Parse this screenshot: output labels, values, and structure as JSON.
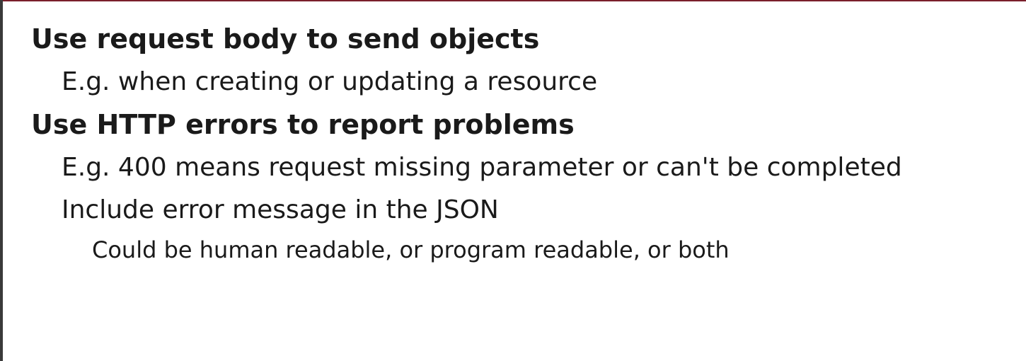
{
  "slide": {
    "items": [
      {
        "heading": "Use request body to send objects",
        "subitems": [
          {
            "text": "E.g. when creating or updating a resource"
          }
        ]
      },
      {
        "heading": "Use HTTP errors to report problems",
        "subitems": [
          {
            "text": "E.g. 400 means request missing parameter or can't be completed"
          },
          {
            "text": "Include error message in the JSON",
            "subitems": [
              {
                "text": "Could be human readable, or program readable, or both"
              }
            ]
          }
        ]
      }
    ]
  },
  "colors": {
    "text": "#1a1a1a",
    "top_border": "#7a1f2b",
    "left_border": "#3a3a3a",
    "background": "#ffffff"
  }
}
